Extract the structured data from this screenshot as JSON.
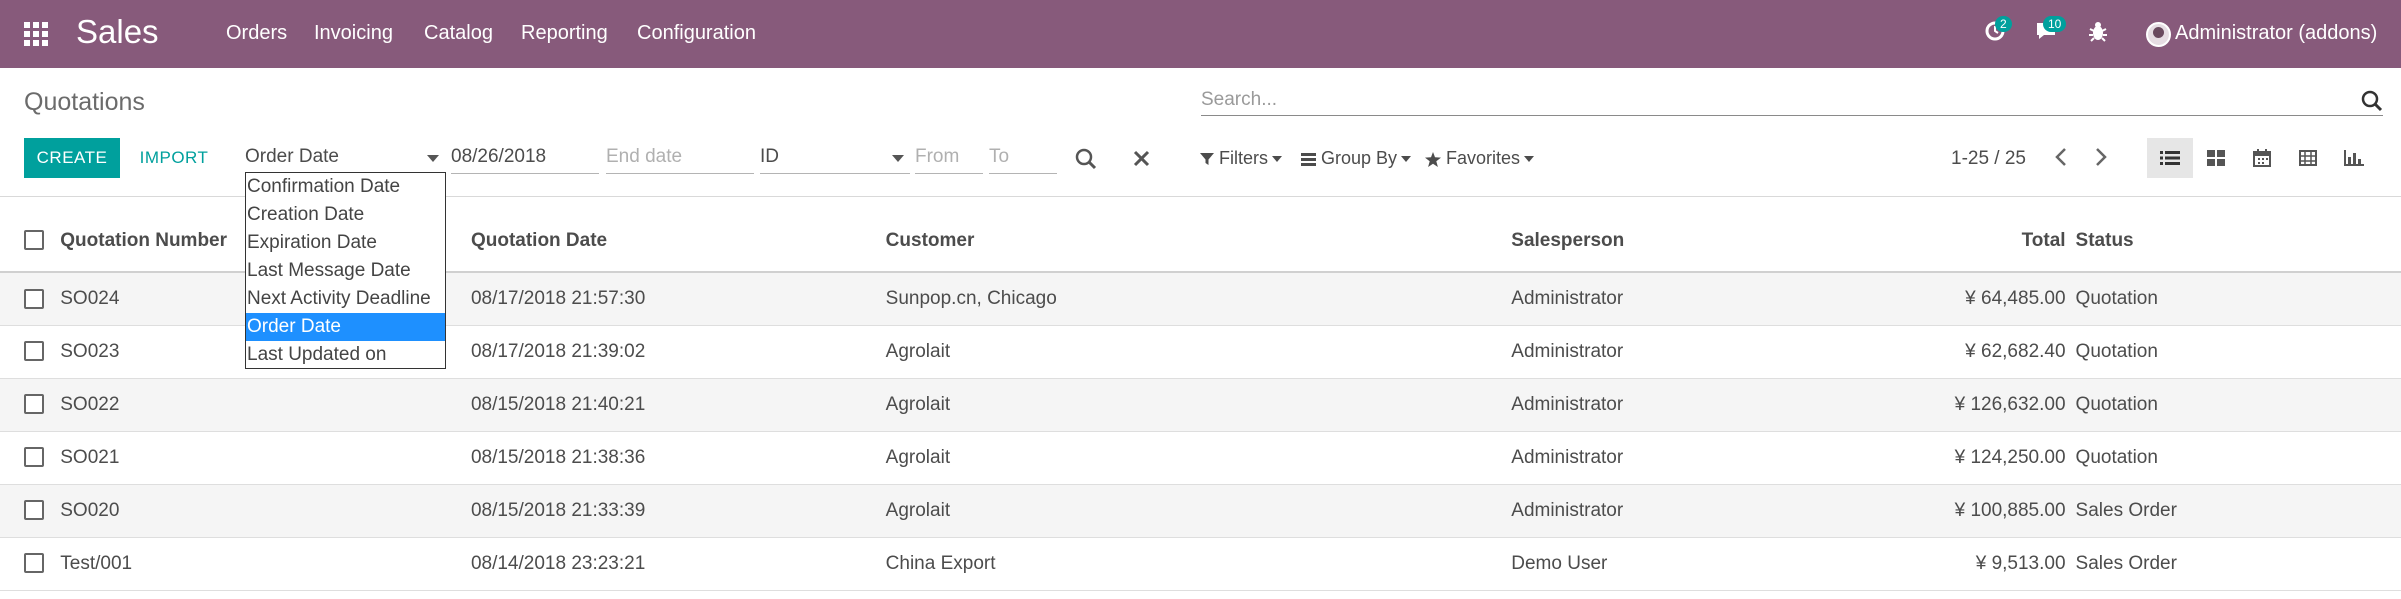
{
  "navbar": {
    "brand": "Sales",
    "menu": [
      "Orders",
      "Invoicing",
      "Catalog",
      "Reporting",
      "Configuration"
    ],
    "activities_count": "2",
    "messages_count": "10",
    "user": "Administrator (addons)"
  },
  "breadcrumb": "Quotations",
  "search": {
    "placeholder": "Search..."
  },
  "buttons": {
    "create": "CREATE",
    "import": "IMPORT"
  },
  "date_filter": {
    "field": "Order Date",
    "start": "08/26/2018",
    "end_placeholder": "End date",
    "options": [
      "Confirmation Date",
      "Creation Date",
      "Expiration Date",
      "Last Message Date",
      "Next Activity Deadline",
      "Order Date",
      "Last Updated on"
    ],
    "selected_index": 5
  },
  "id_filter": {
    "field": "ID",
    "from_placeholder": "From",
    "to_placeholder": "To"
  },
  "filters": {
    "filters": "Filters",
    "group_by": "Group By",
    "favorites": "Favorites"
  },
  "pager": {
    "value": "1-25 / 25"
  },
  "table": {
    "columns": [
      "Quotation Number",
      "Quotation Date",
      "Customer",
      "Salesperson",
      "Total",
      "Status"
    ],
    "rows": [
      {
        "number": "SO024",
        "date": "08/17/2018 21:57:30",
        "customer": "Sunpop.cn, Chicago",
        "salesperson": "Administrator",
        "total": "¥ 64,485.00",
        "status": "Quotation"
      },
      {
        "number": "SO023",
        "date": "08/17/2018 21:39:02",
        "customer": "Agrolait",
        "salesperson": "Administrator",
        "total": "¥ 62,682.40",
        "status": "Quotation"
      },
      {
        "number": "SO022",
        "date": "08/15/2018 21:40:21",
        "customer": "Agrolait",
        "salesperson": "Administrator",
        "total": "¥ 126,632.00",
        "status": "Quotation"
      },
      {
        "number": "SO021",
        "date": "08/15/2018 21:38:36",
        "customer": "Agrolait",
        "salesperson": "Administrator",
        "total": "¥ 124,250.00",
        "status": "Quotation"
      },
      {
        "number": "SO020",
        "date": "08/15/2018 21:33:39",
        "customer": "Agrolait",
        "salesperson": "Administrator",
        "total": "¥ 100,885.00",
        "status": "Sales Order"
      },
      {
        "number": "Test/001",
        "date": "08/14/2018 23:23:21",
        "customer": "China Export",
        "salesperson": "Demo User",
        "total": "¥ 9,513.00",
        "status": "Sales Order"
      }
    ]
  },
  "colors": {
    "navbar": "#875a7b",
    "accent": "#00a09d",
    "selected_option": "#1e90ff"
  }
}
